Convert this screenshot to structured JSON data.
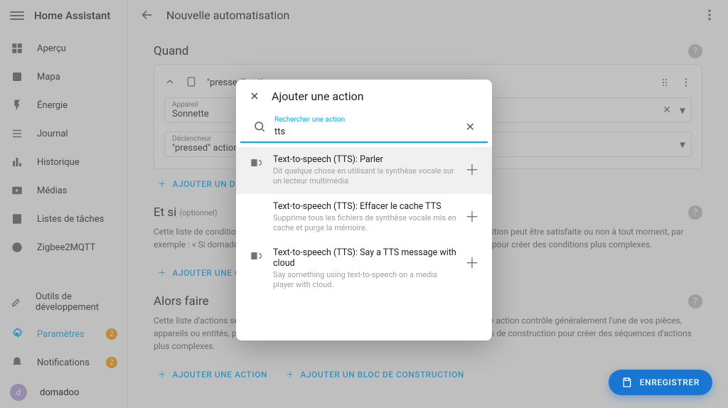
{
  "brand": "Home Assistant",
  "sidebar": {
    "items": [
      {
        "icon": "dashboard",
        "label": "Aperçu"
      },
      {
        "icon": "map",
        "label": "Mapa"
      },
      {
        "icon": "bolt",
        "label": "Énergie"
      },
      {
        "icon": "list",
        "label": "Journal"
      },
      {
        "icon": "chart",
        "label": "Historique"
      },
      {
        "icon": "media",
        "label": "Médias"
      },
      {
        "icon": "tasks",
        "label": "Listes de tâches"
      },
      {
        "icon": "z2m",
        "label": "Zigbee2MQTT"
      }
    ],
    "bottom": [
      {
        "icon": "tools",
        "label": "Outils de développement"
      },
      {
        "icon": "gear",
        "label": "Paramètres",
        "badge": "2",
        "active": true
      },
      {
        "icon": "bell",
        "label": "Notifications",
        "badge": "2"
      }
    ],
    "profile": {
      "initial": "d",
      "name": "domadoo"
    }
  },
  "header": {
    "title": "Nouvelle automatisation"
  },
  "sections": {
    "quand": {
      "title": "Quand",
      "card_title": "\"pressed\" action",
      "device_label": "Appareil",
      "device_value": "Sonnette",
      "trigger_label": "Déclencheur",
      "trigger_value": "\"pressed\" action",
      "add": "AJOUTER UN DÉCLENCHEUR"
    },
    "etsi": {
      "title": "Et si",
      "optional": "(optionnel)",
      "desc": "Cette liste de conditions doit être satisfaite pour que l'automatisation s'exécute. Une condition peut être satisfaite ou non à tout moment, par exemple : « Si domadoo est à la maison ». Vous pouvez utiliser des blocs de construction pour créer des conditions plus complexes.",
      "add": "AJOUTER UNE CONDITION"
    },
    "alors": {
      "title": "Alors faire",
      "desc": "Cette liste d'actions sera effectuée dans l'ordre lors de l'exécution de l'automatisation. Une action contrôle généralement l'une de vos pièces, appareils ou entités, par exemple : « Allumez les lumières ». Vous pouvez utiliser des blocs de construction pour créer des séquences d'actions plus complexes.",
      "add_action": "AJOUTER UNE ACTION",
      "add_block": "AJOUTER UN BLOC DE CONSTRUCTION"
    }
  },
  "dialog": {
    "title": "Ajouter une action",
    "search_label": "Rechercher une action",
    "search_value": "tts",
    "results": [
      {
        "title": "Text-to-speech (TTS): Parler",
        "sub": "Dit quelque chose en utilisant la synthèse vocale sur un lecteur multimédia",
        "icon": true
      },
      {
        "title": "Text-to-speech (TTS): Effacer le cache TTS",
        "sub": "Supprime tous les fichiers de synthèse vocale mis en cache et purge la mémoire.",
        "icon": false
      },
      {
        "title": "Text-to-speech (TTS): Say a TTS message with cloud",
        "sub": "Say something using text-to-speech on a media player with cloud.",
        "icon": true
      }
    ]
  },
  "fab": "ENREGISTRER"
}
